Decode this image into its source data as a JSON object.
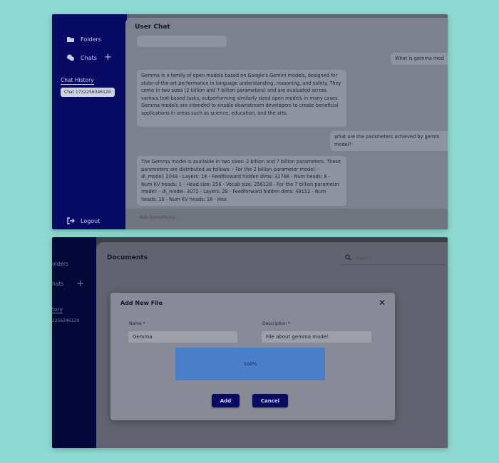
{
  "chat_screen": {
    "sidebar": {
      "folders_label": "Folders",
      "chats_label": "Chats",
      "add_icon": "plus-icon",
      "history_label": "Chat History",
      "history_item": "Chat 1732256346129",
      "logout_label": "Logout"
    },
    "title": "User Chat",
    "messages": [
      {
        "role": "user",
        "text": "What is gemma mod"
      },
      {
        "role": "assistant",
        "text": "Gemma is a family of open models based on Google's Gemini models, designed for state-of-the-art performance in language understanding, reasoning, and safety. They come in two sizes (2 billion and 7 billion parameters) and are evaluated across various text-based tasks, outperforming similarly sized open models in many cases. Gemma models are intended to enable downstream developers to create beneficial applications in areas such as science, education, and the arts."
      },
      {
        "role": "user",
        "text": "what are the parameters achieved by gemm model?"
      },
      {
        "role": "assistant",
        "text": "The Gemma model is available in two sizes: 2 billion and 7 billion parameters. These parameters are distributed as follows: - For the 2 billion parameter model: - d\\_model: 2048 - Layers: 18 - Feedforward hidden dims: 32768 - Num heads: 8 - Num KV heads: 1 - Head size: 256 - Vocab size: 256128 - For the 7 billion parameter model: - d\\_model: 3072 - Layers: 28 - Feedforward hidden dims: 49152 - Num heads: 16 - Num KV heads: 16 - Hea"
      }
    ],
    "input_placeholder": "Ask Something..."
  },
  "documents_screen": {
    "sidebar": {
      "folders_label": "olders",
      "chats_label": "hats",
      "history_label": "tory",
      "history_item": "2256346129"
    },
    "title": "Documents",
    "search_placeholder": "Search",
    "modal": {
      "title": "Add New File",
      "close_icon": "close-icon",
      "name_label": "Name *",
      "name_value": "Gemma",
      "description_label": "Description *",
      "description_value": "File about gemma model",
      "progress_percent": 100,
      "progress_text": "100%",
      "add_label": "Add",
      "cancel_label": "Cancel"
    }
  },
  "colors": {
    "sidebar": "#070b63",
    "backdrop": "#8fd9d3",
    "progress": "#4a7ec9",
    "button": "#070b63"
  }
}
